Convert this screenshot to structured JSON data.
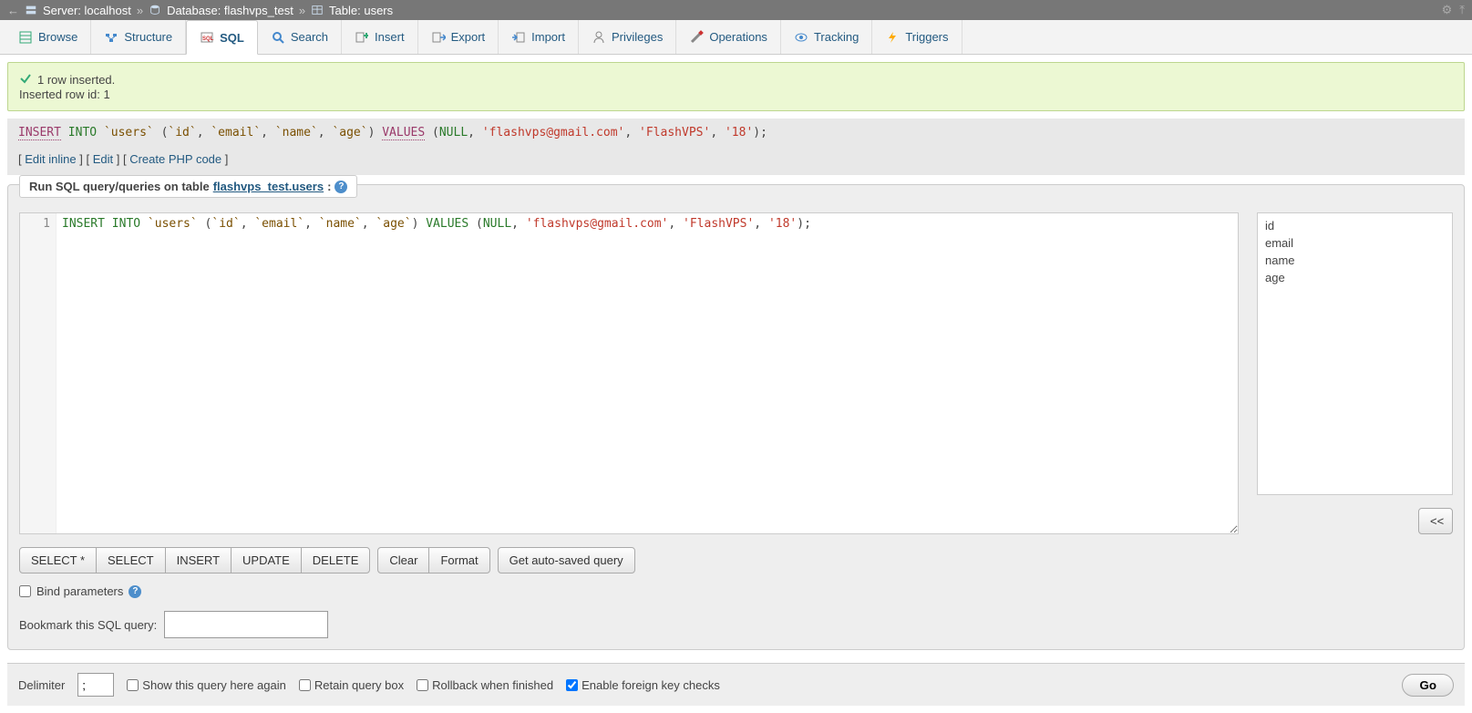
{
  "breadcrumb": {
    "server_label": "Server: localhost",
    "db_label": "Database: flashvps_test",
    "table_label": "Table: users",
    "sep": "»"
  },
  "tabs": {
    "browse": "Browse",
    "structure": "Structure",
    "sql": "SQL",
    "search": "Search",
    "insert": "Insert",
    "export": "Export",
    "import": "Import",
    "privileges": "Privileges",
    "operations": "Operations",
    "tracking": "Tracking",
    "triggers": "Triggers"
  },
  "success": {
    "line1": "1 row inserted.",
    "line2": "Inserted row id: 1"
  },
  "sql_echo": {
    "insert": "INSERT",
    "into": "INTO",
    "table": "`users`",
    "open": "(",
    "c_id": "`id`",
    "c_email": "`email`",
    "c_name": "`name`",
    "c_age": "`age`",
    "close": ")",
    "values": "VALUES",
    "open2": "(",
    "null": "NULL",
    "v_email": "'flashvps@gmail.com'",
    "v_name": "'FlashVPS'",
    "v_age": "'18'",
    "close2": ");",
    "comma": ","
  },
  "sql_actions": {
    "lb": "[ ",
    "rb": " ]",
    "edit_inline": "Edit inline",
    "edit": "Edit",
    "create_php": "Create PHP code"
  },
  "fieldset": {
    "run_prefix": "Run SQL query/queries on table ",
    "run_target": "flashvps_test.users",
    "run_suffix": ":"
  },
  "editor": {
    "line_no": "1",
    "insert_into": "INSERT INTO",
    "table": "`users`",
    "open": "(",
    "c_id": "`id`",
    "c_email": "`email`",
    "c_name": "`name`",
    "c_age": "`age`",
    "close": ")",
    "values": "VALUES",
    "open2": "(",
    "null": "NULL",
    "v_email": "'flashvps@gmail.com'",
    "v_name": "'FlashVPS'",
    "v_age": "'18'",
    "close2": ");",
    "comma": ","
  },
  "columns": [
    "id",
    "email",
    "name",
    "age"
  ],
  "buttons": {
    "select_star": "SELECT *",
    "select": "SELECT",
    "insert": "INSERT",
    "update": "UPDATE",
    "delete": "DELETE",
    "clear": "Clear",
    "format": "Format",
    "auto_saved": "Get auto-saved query",
    "move_left": "<<"
  },
  "bind_params": "Bind parameters",
  "bookmark": {
    "label": "Bookmark this SQL query:",
    "value": ""
  },
  "bottom": {
    "delimiter_label": "Delimiter",
    "delimiter_value": ";",
    "show_again": "Show this query here again",
    "retain": "Retain query box",
    "rollback": "Rollback when finished",
    "fk": "Enable foreign key checks",
    "go": "Go"
  }
}
